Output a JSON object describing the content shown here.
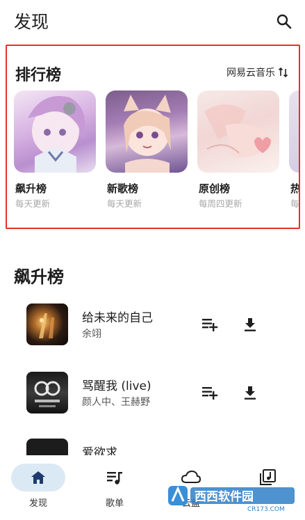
{
  "header": {
    "title": "发现"
  },
  "charts": {
    "title": "排行榜",
    "source_label": "网易云音乐",
    "cards": [
      {
        "name": "飙升榜",
        "update": "每天更新"
      },
      {
        "name": "新歌榜",
        "update": "每天更新"
      },
      {
        "name": "原创榜",
        "update": "每周四更新"
      },
      {
        "name": "热",
        "update": "每"
      }
    ]
  },
  "list": {
    "title": "飙升榜",
    "songs": [
      {
        "title": "给未来的自己",
        "artist": "余翊"
      },
      {
        "title": "骂醒我 (live)",
        "artist": "颜人中、王赫野"
      },
      {
        "title": "爱欲求",
        "artist": ""
      }
    ]
  },
  "nav": {
    "items": [
      {
        "label": "发现"
      },
      {
        "label": "歌单"
      },
      {
        "label": "云盘"
      },
      {
        "label": ""
      }
    ]
  },
  "watermark": {
    "text": "西西软件园",
    "url": "CR173.COM"
  },
  "colors": {
    "highlight_border": "#e2322d",
    "active_nav": "#dbe9f5",
    "icon": "#1e1e1e"
  }
}
